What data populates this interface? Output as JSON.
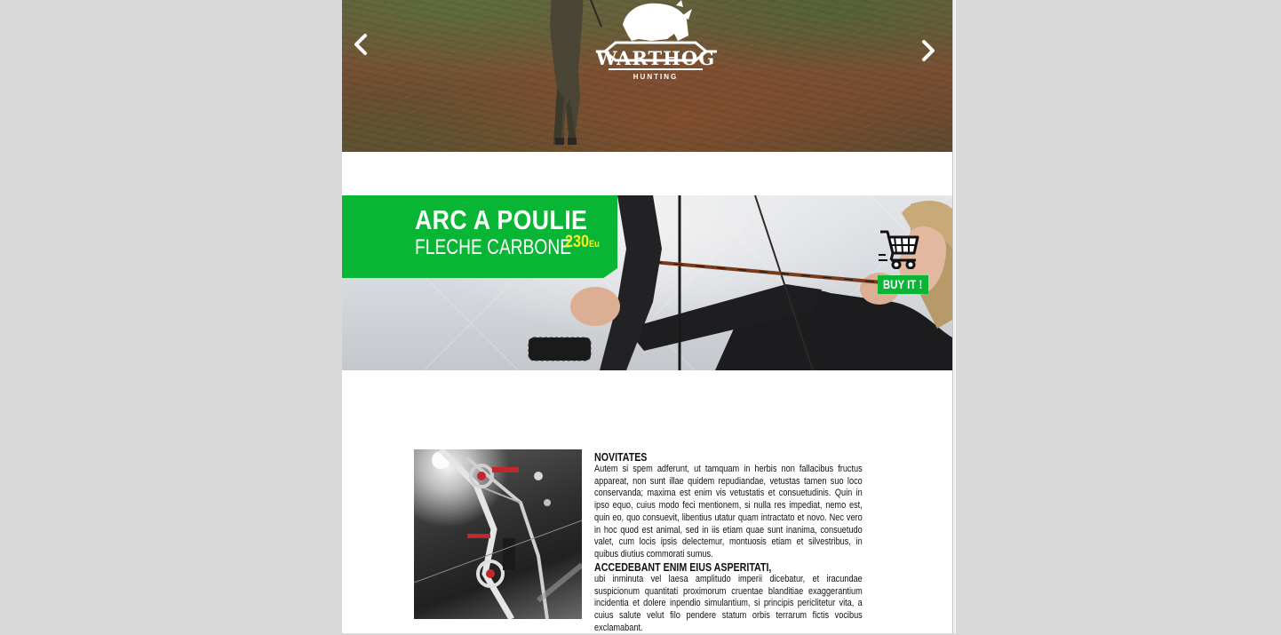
{
  "hero": {
    "logo_text": "WARTHOG",
    "logo_subtext": "HUNTING",
    "prev_icon": "chevron-left-icon",
    "next_icon": "chevron-right-icon"
  },
  "promo": {
    "title": "ARC A POULIE",
    "subtitle": "FLECHE CARBONE",
    "price": "230",
    "currency": "Eu",
    "buy_label": "BUY IT !",
    "cart_icon": "shopping-cart-icon",
    "brand_color": "#09b534",
    "price_color": "#f2f21e"
  },
  "article": {
    "sections": [
      {
        "title": "NOVITATES",
        "body": "Autem si spem adferunt, ut tamquam in herbis non fallacibus fructus appareat, non sunt illae quidem repudiandae, vetustas tamen suo loco conservanda; maxima est enim vis vetustatis et consuetudinis. Quin in ipso equo, cuius modo feci mentionem, si nulla res impediat, nemo est, quin eo, quo consuevit, libentius utatur quam intractato et novo. Nec vero in hoc quod est animal, sed in iis etiam quae sunt inanima, consuetudo valet, cum locis ipsis delectemur, montuosis etiam et silvestribus, in quibus diutius commorati sumus."
      },
      {
        "title": "ACCEDEBANT ENIM EIUS ASPERITATI,",
        "body": "ubi inminuta vel laesa amplitudo imperii dicebatur, et iracundae suspicionum quantitati proximorum cruentae blanditiae exaggerantium incidentia et dolere inpendio simulantium, si principis periclitetur vita, a cuius salute velut filo pendere statum orbis terrarum fictis vocibus exclamabant."
      }
    ]
  }
}
